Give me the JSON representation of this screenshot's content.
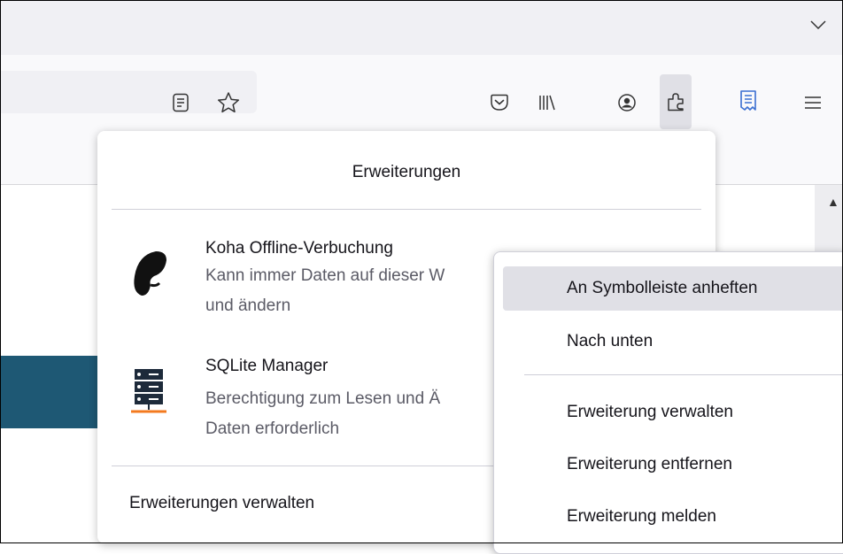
{
  "toolbar": {
    "icons": [
      "reader-view-icon",
      "bookmark-star-icon",
      "pocket-icon",
      "library-icon",
      "account-icon",
      "extensions-icon",
      "bookmark-extension-icon",
      "menu-icon"
    ]
  },
  "extensions_panel": {
    "title": "Erweiterungen",
    "items": [
      {
        "name": "Koha Offline-Verbuchung",
        "desc_line1": "Kann immer Daten auf dieser W",
        "desc_line2": "und ändern"
      },
      {
        "name": "SQLite Manager",
        "desc_line1": "Berechtigung zum Lesen und Ä",
        "desc_line2": "Daten erforderlich"
      }
    ],
    "footer": "Erweiterungen verwalten"
  },
  "context_menu": {
    "items": [
      {
        "label": "An Symbolleiste anheften"
      },
      {
        "label": "Nach unten"
      },
      {
        "label": "Erweiterung verwalten"
      },
      {
        "label": "Erweiterung entfernen"
      },
      {
        "label": "Erweiterung melden"
      }
    ]
  },
  "colors": {
    "accent_blue": "#0060df",
    "teal_band": "#1e5874",
    "sqlite_orange": "#f37a1f"
  }
}
